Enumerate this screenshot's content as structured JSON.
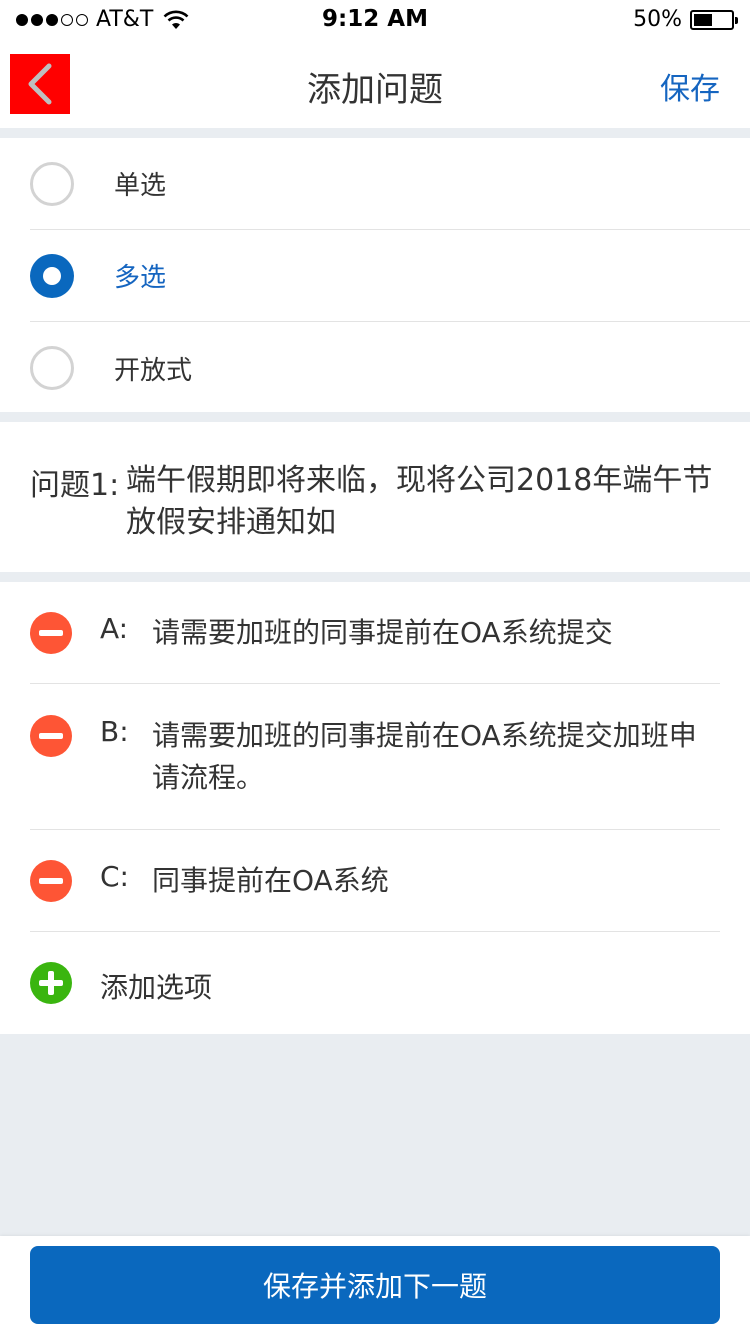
{
  "status_bar": {
    "carrier": "AT&T",
    "time": "9:12 AM",
    "battery": "50%",
    "battery_level": 0.5,
    "signal_bars": 3,
    "signal_total": 5
  },
  "nav": {
    "back_icon": "chevron-left-icon",
    "title": "添加问题",
    "save_label": "保存"
  },
  "question_types": [
    {
      "label": "单选",
      "selected": false
    },
    {
      "label": "多选",
      "selected": true
    },
    {
      "label": "开放式",
      "selected": false
    }
  ],
  "question": {
    "prefix": "问题1:",
    "text": "端午假期即将来临，现将公司2018年端午节放假安排通知如"
  },
  "options": [
    {
      "letter": "A:",
      "text": "请需要加班的同事提前在OA系统提交"
    },
    {
      "letter": "B:",
      "text": "请需要加班的同事提前在OA系统提交加班申请流程。"
    },
    {
      "letter": "C:",
      "text": "同事提前在OA系统"
    }
  ],
  "add_option_label": "添加选项",
  "bottom_button_label": "保存并添加下一题",
  "colors": {
    "accent": "#0a68be",
    "delete": "#fe5535",
    "add": "#3ab50f",
    "back_bg": "#ff0000",
    "page_bg": "#e9edf1"
  }
}
